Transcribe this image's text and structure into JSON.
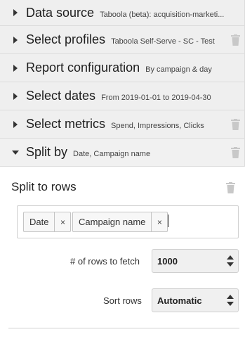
{
  "sections": [
    {
      "title": "Data source",
      "subtitle": "Taboola (beta): acquisition-marketi...",
      "trash": false
    },
    {
      "title": "Select profiles",
      "subtitle": "Taboola Self-Serve - SC - Test",
      "trash": true
    },
    {
      "title": "Report configuration",
      "subtitle": "By campaign & day",
      "trash": false
    },
    {
      "title": "Select dates",
      "subtitle": "From 2019-01-01 to 2019-04-30",
      "trash": false
    },
    {
      "title": "Select metrics",
      "subtitle": "Spend, Impressions, Clicks",
      "trash": true
    },
    {
      "title": "Split by",
      "subtitle": "Date, Campaign name",
      "trash": true
    }
  ],
  "split": {
    "rows_title": "Split to rows",
    "chips": [
      {
        "label": "Date",
        "remove": "×"
      },
      {
        "label": "Campaign name",
        "remove": "×"
      }
    ],
    "rows_to_fetch_label": "# of rows to fetch",
    "rows_to_fetch_value": "1000",
    "sort_rows_label": "Sort rows",
    "sort_rows_value": "Automatic"
  },
  "icons": {
    "collapsed": "caret-right-icon",
    "expanded": "caret-down-icon",
    "delete": "trash-icon"
  },
  "colors": {
    "header_bg": "#efefef",
    "icon_gray": "#c8c8c8"
  }
}
